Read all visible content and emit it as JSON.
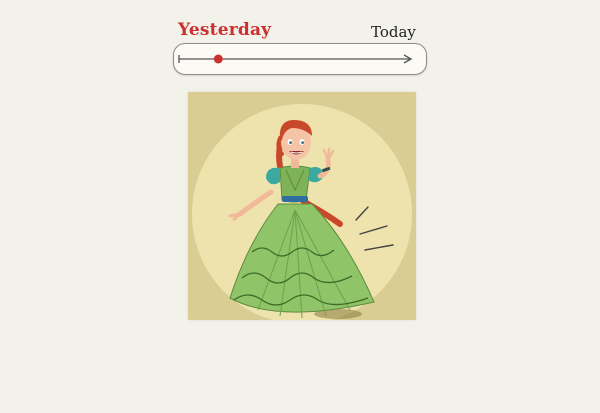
{
  "timeline": {
    "start_label": "Yesterday",
    "end_label": "Today",
    "position": 0.17,
    "accent_color": "#cc2f2f"
  },
  "picture": {
    "icon": "princess-illustration",
    "background_color": "#d9cd94",
    "circle_color": "#efe3ad",
    "dress_color": "#90c469"
  }
}
